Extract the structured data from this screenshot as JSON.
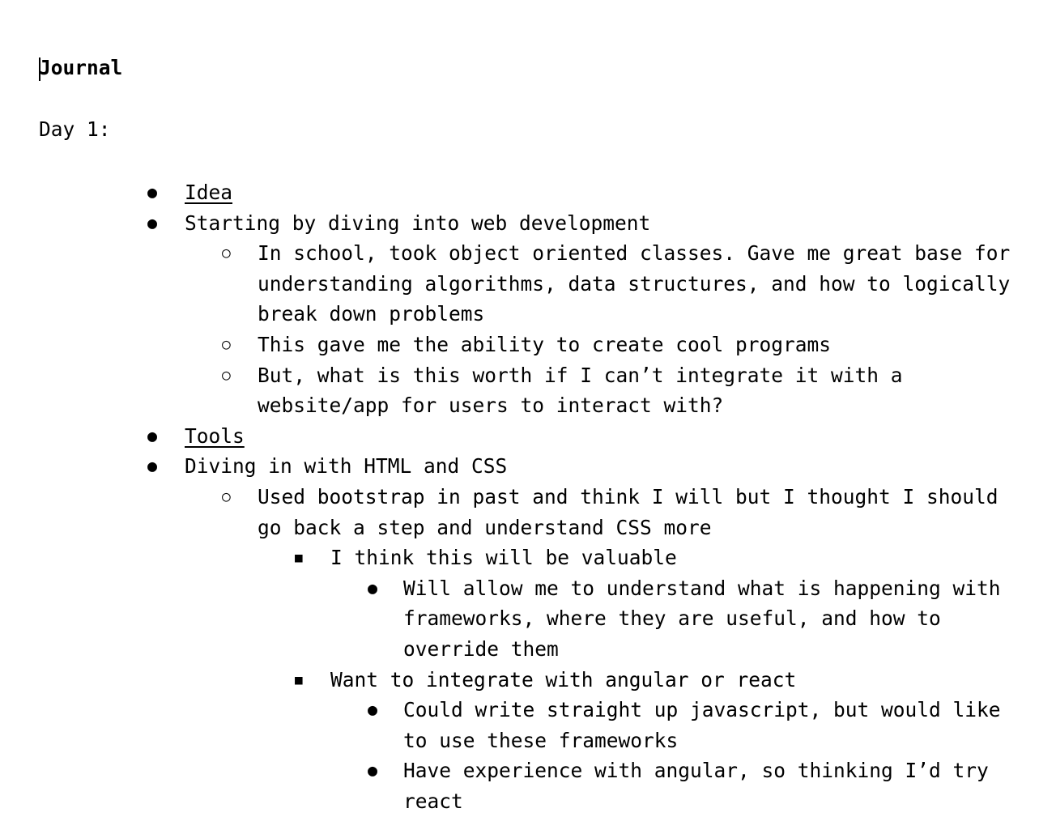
{
  "document": {
    "title": "Journal",
    "day_heading": "Day 1:",
    "items": [
      {
        "level": 1,
        "bullet": "●",
        "text": "Idea",
        "underline": true
      },
      {
        "level": 1,
        "bullet": "●",
        "text": "Starting by diving into web development",
        "underline": false
      },
      {
        "level": 2,
        "bullet": "○",
        "text": "In school, took object oriented classes. Gave me great base for understanding algorithms, data structures, and how to logically break down problems",
        "underline": false
      },
      {
        "level": 2,
        "bullet": "○",
        "text": "This gave me the ability to create cool programs",
        "underline": false
      },
      {
        "level": 2,
        "bullet": "○",
        "text": "But, what is this worth if I can’t integrate it with a website/app for users to interact with?",
        "underline": false
      },
      {
        "level": 1,
        "bullet": "●",
        "text": "Tools",
        "underline": true
      },
      {
        "level": 1,
        "bullet": "●",
        "text": "Diving in with HTML and CSS",
        "underline": false
      },
      {
        "level": 2,
        "bullet": "○",
        "text": "Used bootstrap in past and think I will but I thought I should go back a step and understand CSS more",
        "underline": false
      },
      {
        "level": 3,
        "bullet": "■",
        "text": "I think this will be valuable",
        "underline": false
      },
      {
        "level": 4,
        "bullet": "●",
        "text": "Will allow me to understand what is happening with frameworks, where they are useful, and how to override them",
        "underline": false
      },
      {
        "level": 3,
        "bullet": "■",
        "text": "Want to integrate with angular or react",
        "underline": false
      },
      {
        "level": 4,
        "bullet": "●",
        "text": "Could write straight up javascript, but would like to use these frameworks",
        "underline": false
      },
      {
        "level": 4,
        "bullet": "●",
        "text": "Have experience with angular, so thinking I’d try react",
        "underline": false
      }
    ]
  }
}
